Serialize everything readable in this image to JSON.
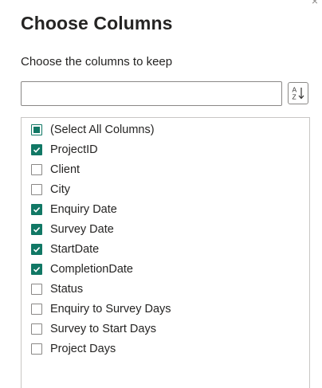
{
  "dialog": {
    "title": "Choose Columns",
    "subtitle": "Choose the columns to keep",
    "close_glyph": "×",
    "search": {
      "value": "",
      "placeholder": ""
    },
    "sort_icon": "sort-az-icon"
  },
  "columns": {
    "items": [
      {
        "label": "(Select All Columns)",
        "state": "partial"
      },
      {
        "label": "ProjectID",
        "state": "checked"
      },
      {
        "label": "Client",
        "state": "unchecked"
      },
      {
        "label": "City",
        "state": "unchecked"
      },
      {
        "label": "Enquiry Date",
        "state": "checked"
      },
      {
        "label": "Survey Date",
        "state": "checked"
      },
      {
        "label": "StartDate",
        "state": "checked"
      },
      {
        "label": "CompletionDate",
        "state": "checked"
      },
      {
        "label": "Status",
        "state": "unchecked"
      },
      {
        "label": "Enquiry to Survey Days",
        "state": "unchecked"
      },
      {
        "label": "Survey to Start Days",
        "state": "unchecked"
      },
      {
        "label": "Project Days",
        "state": "unchecked"
      }
    ]
  },
  "colors": {
    "accent": "#117865",
    "border": "#8a8886",
    "text": "#252423"
  }
}
